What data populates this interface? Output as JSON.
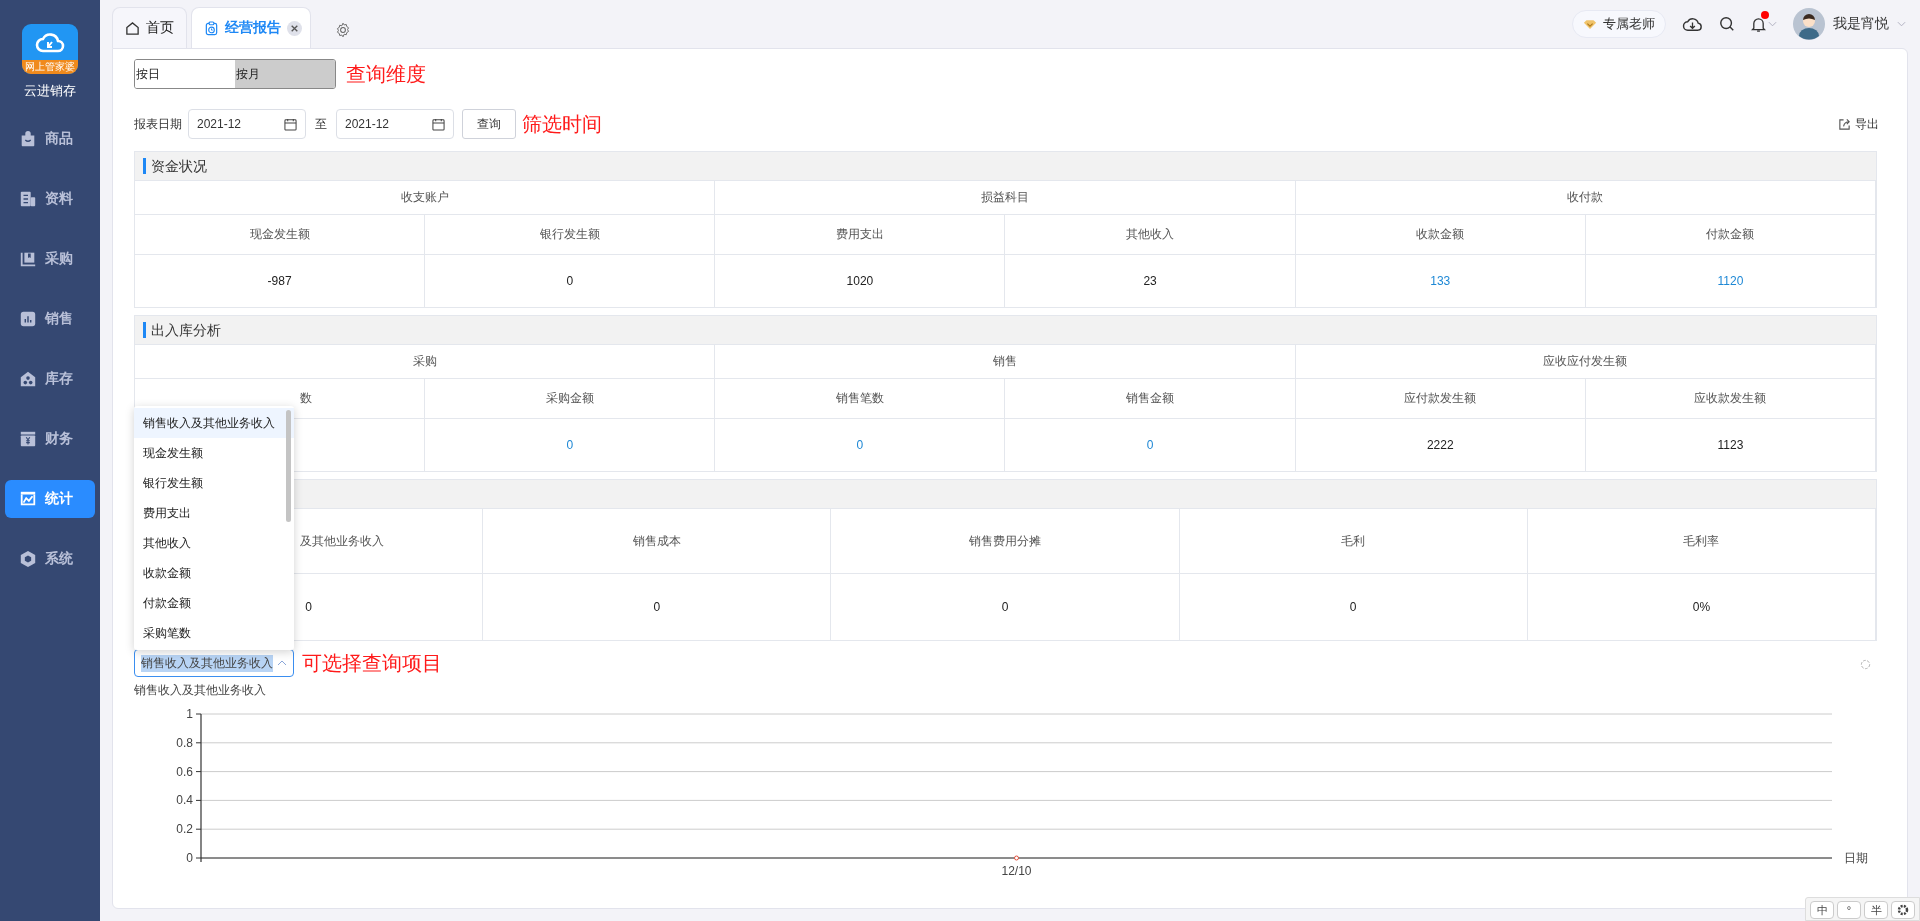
{
  "sidebar": {
    "logo_badge": "网上管家婆",
    "app_name": "云进销存",
    "items": [
      {
        "label": "商品",
        "selected": false
      },
      {
        "label": "资料",
        "selected": false
      },
      {
        "label": "采购",
        "selected": false
      },
      {
        "label": "销售",
        "selected": false
      },
      {
        "label": "库存",
        "selected": false
      },
      {
        "label": "财务",
        "selected": false
      },
      {
        "label": "统计",
        "selected": true
      },
      {
        "label": "系统",
        "selected": false
      }
    ]
  },
  "tabs": [
    {
      "label": "首页",
      "selected": false,
      "closable": false
    },
    {
      "label": "经营报告",
      "selected": true,
      "closable": true
    }
  ],
  "header": {
    "teacher_button": "专属老师",
    "has_unread": true,
    "user_name": "我是宵悦"
  },
  "dimension_toggle": {
    "options": [
      {
        "label": "按日",
        "selected": false
      },
      {
        "label": "按月",
        "selected": true
      }
    ],
    "note": "查询维度"
  },
  "filter": {
    "label": "报表日期",
    "start": "2021-12",
    "separator": "至",
    "end": "2021-12",
    "button": "查询",
    "note": "筛选时间",
    "export": "导出"
  },
  "sections": [
    {
      "title": "资金状况",
      "groups": [
        {
          "label": "收支账户",
          "columns": [
            {
              "header": "现金发生额",
              "value": "-987",
              "link": false
            },
            {
              "header": "银行发生额",
              "value": "0",
              "link": false
            }
          ]
        },
        {
          "label": "损益科目",
          "columns": [
            {
              "header": "费用支出",
              "value": "1020",
              "link": false
            },
            {
              "header": "其他收入",
              "value": "23",
              "link": false
            }
          ]
        },
        {
          "label": "收付款",
          "columns": [
            {
              "header": "收款金额",
              "value": "133",
              "link": true
            },
            {
              "header": "付款金额",
              "value": "1120",
              "link": true
            }
          ]
        }
      ]
    },
    {
      "title": "出入库分析",
      "groups": [
        {
          "label": "采购",
          "columns": [
            {
              "header": "数",
              "partly_hidden": true
            },
            {
              "header": "采购金额",
              "value": "0",
              "link": true
            }
          ]
        },
        {
          "label": "销售",
          "columns": [
            {
              "header": "销售笔数",
              "value": "0",
              "link": true
            },
            {
              "header": "销售金额",
              "value": "0",
              "link": true
            }
          ]
        },
        {
          "label": "应收应付发生额",
          "columns": [
            {
              "header": "应付款发生额",
              "value": "2222",
              "link": false
            },
            {
              "header": "应收款发生额",
              "value": "1123",
              "link": false
            }
          ]
        }
      ]
    },
    {
      "columns": [
        {
          "header": "及其他业务收入",
          "partly_hidden": true,
          "value": "0",
          "link": false
        },
        {
          "header": "销售成本",
          "value": "0",
          "link": false
        },
        {
          "header": "销售费用分摊",
          "value": "0",
          "link": false
        },
        {
          "header": "毛利",
          "value": "0",
          "link": false
        },
        {
          "header": "毛利率",
          "value": "0%",
          "link": false
        }
      ]
    }
  ],
  "item_select": {
    "value": "销售收入及其他业务收入",
    "expanded": true,
    "note": "可选择查询项目",
    "options": [
      {
        "label": "销售收入及其他业务收入",
        "selected": true
      },
      {
        "label": "现金发生额",
        "selected": false
      },
      {
        "label": "银行发生额",
        "selected": false
      },
      {
        "label": "费用支出",
        "selected": false
      },
      {
        "label": "其他收入",
        "selected": false
      },
      {
        "label": "收款金额",
        "selected": false
      },
      {
        "label": "付款金额",
        "selected": false
      },
      {
        "label": "采购笔数",
        "selected": false
      }
    ]
  },
  "chart": {
    "chart_data": {
      "type": "line",
      "title": "销售收入及其他业务收入",
      "xlabel": "日期",
      "categories": [
        "12/10"
      ],
      "series": [
        {
          "color": "#e0503c",
          "marker": "circle",
          "values": [
            0
          ]
        }
      ],
      "grid": true,
      "ylim": [
        0,
        1
      ],
      "yticks": [
        0,
        0.2,
        0.4,
        0.6,
        0.8,
        1
      ]
    }
  },
  "ime_toolbar": {
    "keys": [
      "中",
      "°",
      "半"
    ]
  }
}
